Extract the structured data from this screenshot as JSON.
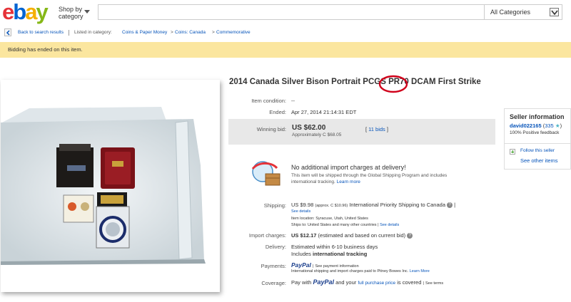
{
  "header": {
    "shop_by_line1": "Shop by",
    "shop_by_line2": "category",
    "search_placeholder": "",
    "category_select": "All Categories"
  },
  "breadcrumb": {
    "back_label": "Back to search results",
    "listed_in": "Listed in category:",
    "items": [
      "Coins & Paper Money",
      "Coins: Canada",
      "Commemorative"
    ]
  },
  "status": "Bidding has ended on this item.",
  "item": {
    "title_before": "2014 Canada Silver Bison Portrait PCGS ",
    "title_mark": "PR70",
    "title_after": " DCAM First Strike",
    "condition_label": "Item condition:",
    "condition_value": "--",
    "ended_label": "Ended:",
    "ended_value": "Apr 27, 2014  21:14:31 EDT",
    "winning_label": "Winning bid:",
    "winning_value": "US $62.00",
    "winning_approx": "Approximately C $68.05",
    "bids": "11 bids"
  },
  "import_notice": {
    "heading": "No additional import charges at delivery!",
    "line1": "This item will be shipped through the Global Shipping Program and includes",
    "line2": "international tracking.",
    "learn_more": "Learn more"
  },
  "shipping": {
    "label": "Shipping:",
    "price": "US $9.98",
    "approx": "(approx. C $10.96)",
    "method": "International Priority Shipping to Canada",
    "see_details": "See details",
    "location_label": "Item location:",
    "location": "Syracuse, Utah, United States",
    "ships_to_label": "Ships to:",
    "ships_to": "United States and many other countries",
    "see_details2": "See details"
  },
  "import_charges": {
    "label": "Import charges:",
    "value": "US $12.17",
    "note": "(estimated and based on current bid)"
  },
  "delivery": {
    "label": "Delivery:",
    "line1": "Estimated within 6-10 business days",
    "line2_prefix": "Includes",
    "line2_bold": "international tracking"
  },
  "payments": {
    "label": "Payments:",
    "paypal": "PayPal",
    "see_info": "See payment information",
    "note": "International shipping and import charges paid to Pitney Bowes Inc.",
    "learn_more": "Learn More"
  },
  "coverage": {
    "label": "Coverage:",
    "pay_with": "Pay with",
    "paypal": "PayPal",
    "and_your": "and your",
    "full_purchase": "full purchase price",
    "is_covered": "is covered",
    "see_terms": "See terms"
  },
  "seller": {
    "heading": "Seller information",
    "name": "david022165",
    "score": "335",
    "feedback": "100% Positive feedback",
    "follow": "Follow this seller",
    "see_other": "See other items"
  },
  "colors": {
    "link": "#0654ba",
    "status_bg": "#fbe69f",
    "mark": "#d0021b"
  }
}
